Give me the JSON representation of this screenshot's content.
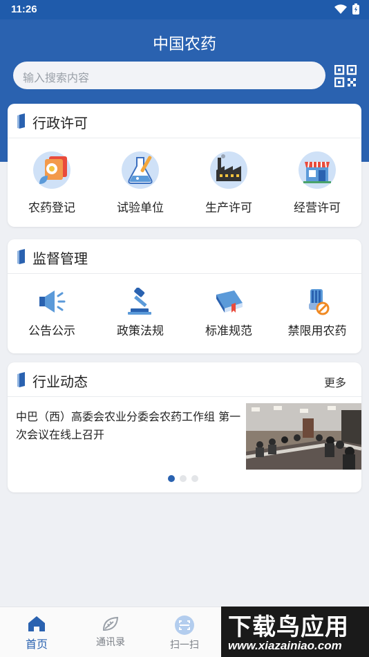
{
  "status_bar": {
    "time": "11:26"
  },
  "header": {
    "title": "中国农药"
  },
  "search": {
    "placeholder": "输入搜索内容"
  },
  "sections": {
    "admin": {
      "title": "行政许可",
      "items": [
        {
          "label": "农药登记",
          "icon": "pesticide-registration-icon"
        },
        {
          "label": "试验单位",
          "icon": "test-lab-flask-icon"
        },
        {
          "label": "生产许可",
          "icon": "factory-icon"
        },
        {
          "label": "经营许可",
          "icon": "shop-icon"
        }
      ]
    },
    "supervision": {
      "title": "监督管理",
      "items": [
        {
          "label": "公告公示",
          "icon": "megaphone-icon"
        },
        {
          "label": "政策法规",
          "icon": "gavel-icon"
        },
        {
          "label": "标准规范",
          "icon": "book-icon"
        },
        {
          "label": "禁限用农药",
          "icon": "banned-pesticide-icon"
        }
      ]
    },
    "news": {
      "title": "行业动态",
      "more": "更多",
      "headline": "中巴（西）高委会农业分委会农药工作组 第一次会议在线上召开",
      "active_slide": 1,
      "slide_count": 3
    }
  },
  "tabbar": {
    "items": [
      {
        "label": "首页",
        "active": true
      },
      {
        "label": "通讯录",
        "active": false
      },
      {
        "label": "扫一扫",
        "active": false
      }
    ]
  },
  "watermark": {
    "line1": "下载鸟应用",
    "line2": "www.xiazainiao.com"
  },
  "colors": {
    "primary": "#2a62b0",
    "status_bar": "#1f5bab",
    "background": "#eef0f4"
  }
}
